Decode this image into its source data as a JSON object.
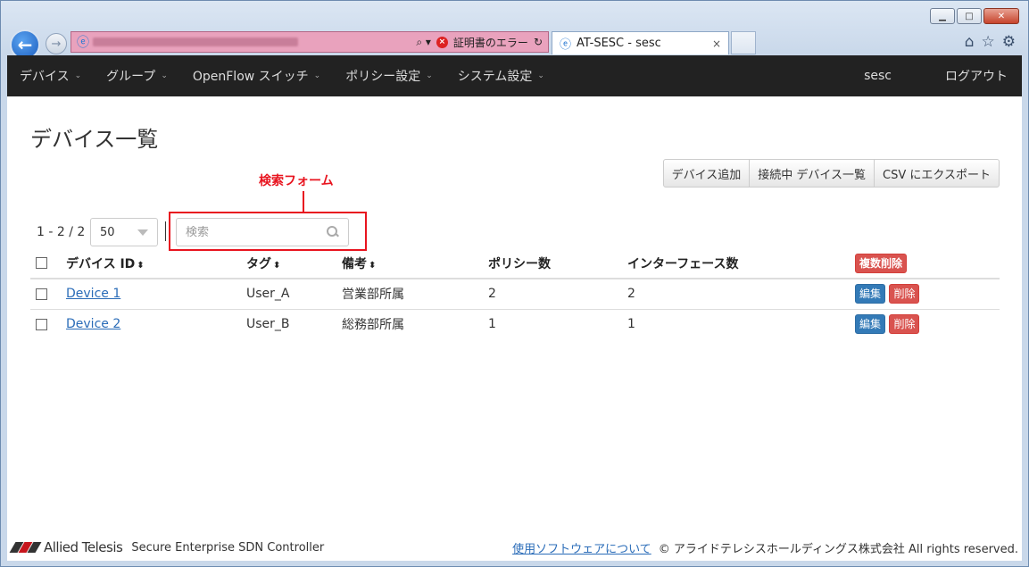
{
  "browser": {
    "tab_title": "AT-SESC - sesc",
    "tab_close": "×",
    "cert_error": "証明書のエラー",
    "cert_error_mark": "×",
    "search_glyph": "⌕ ▾",
    "refresh_glyph": "↻",
    "back_glyph": "←",
    "forward_glyph": "→",
    "minimize": "▁",
    "maximize": "□",
    "close": "✕",
    "home_icon": "⌂",
    "favorites_icon": "☆",
    "tools_icon": "⚙",
    "ie_glyph": "ⓔ"
  },
  "navbar": {
    "items": [
      {
        "label": "デバイス"
      },
      {
        "label": "グループ"
      },
      {
        "label": "OpenFlow スイッチ"
      },
      {
        "label": "ポリシー設定"
      },
      {
        "label": "システム設定"
      }
    ],
    "caret": "⌄",
    "user": "sesc",
    "logout": "ログアウト"
  },
  "page": {
    "title": "デバイス一覧",
    "buttons": {
      "add": "デバイス追加",
      "connected": "接続中 デバイス一覧",
      "export": "CSV にエクスポート"
    },
    "annotation": "検索フォーム",
    "range": "1 - 2 / 2",
    "page_size": "50",
    "search_placeholder": "検索"
  },
  "table": {
    "headers": {
      "device_id": "デバイス ID",
      "tag": "タグ",
      "note": "備考",
      "policies": "ポリシー数",
      "interfaces": "インターフェース数",
      "bulk_delete": "複数削除"
    },
    "sort_glyph": "⬍",
    "edit_label": "編集",
    "delete_label": "削除",
    "rows": [
      {
        "device": "Device 1",
        "tag": "User_A",
        "note": "営業部所属",
        "policies": "2",
        "interfaces": "2"
      },
      {
        "device": "Device 2",
        "tag": "User_B",
        "note": "総務部所属",
        "policies": "1",
        "interfaces": "1"
      }
    ]
  },
  "footer": {
    "brand": "Allied Telesis",
    "product": "Secure Enterprise SDN Controller",
    "link": "使用ソフトウェアについて",
    "copyright": "© アライドテレシスホールディングス株式会社 All rights reserved."
  },
  "colors": {
    "navbar_bg": "#222222",
    "annotation": "#e8141f",
    "edit_button": "#337ab7",
    "delete_button": "#d9534f",
    "link": "#2a6cb8",
    "address_bar_error": "#e9a2bd"
  }
}
